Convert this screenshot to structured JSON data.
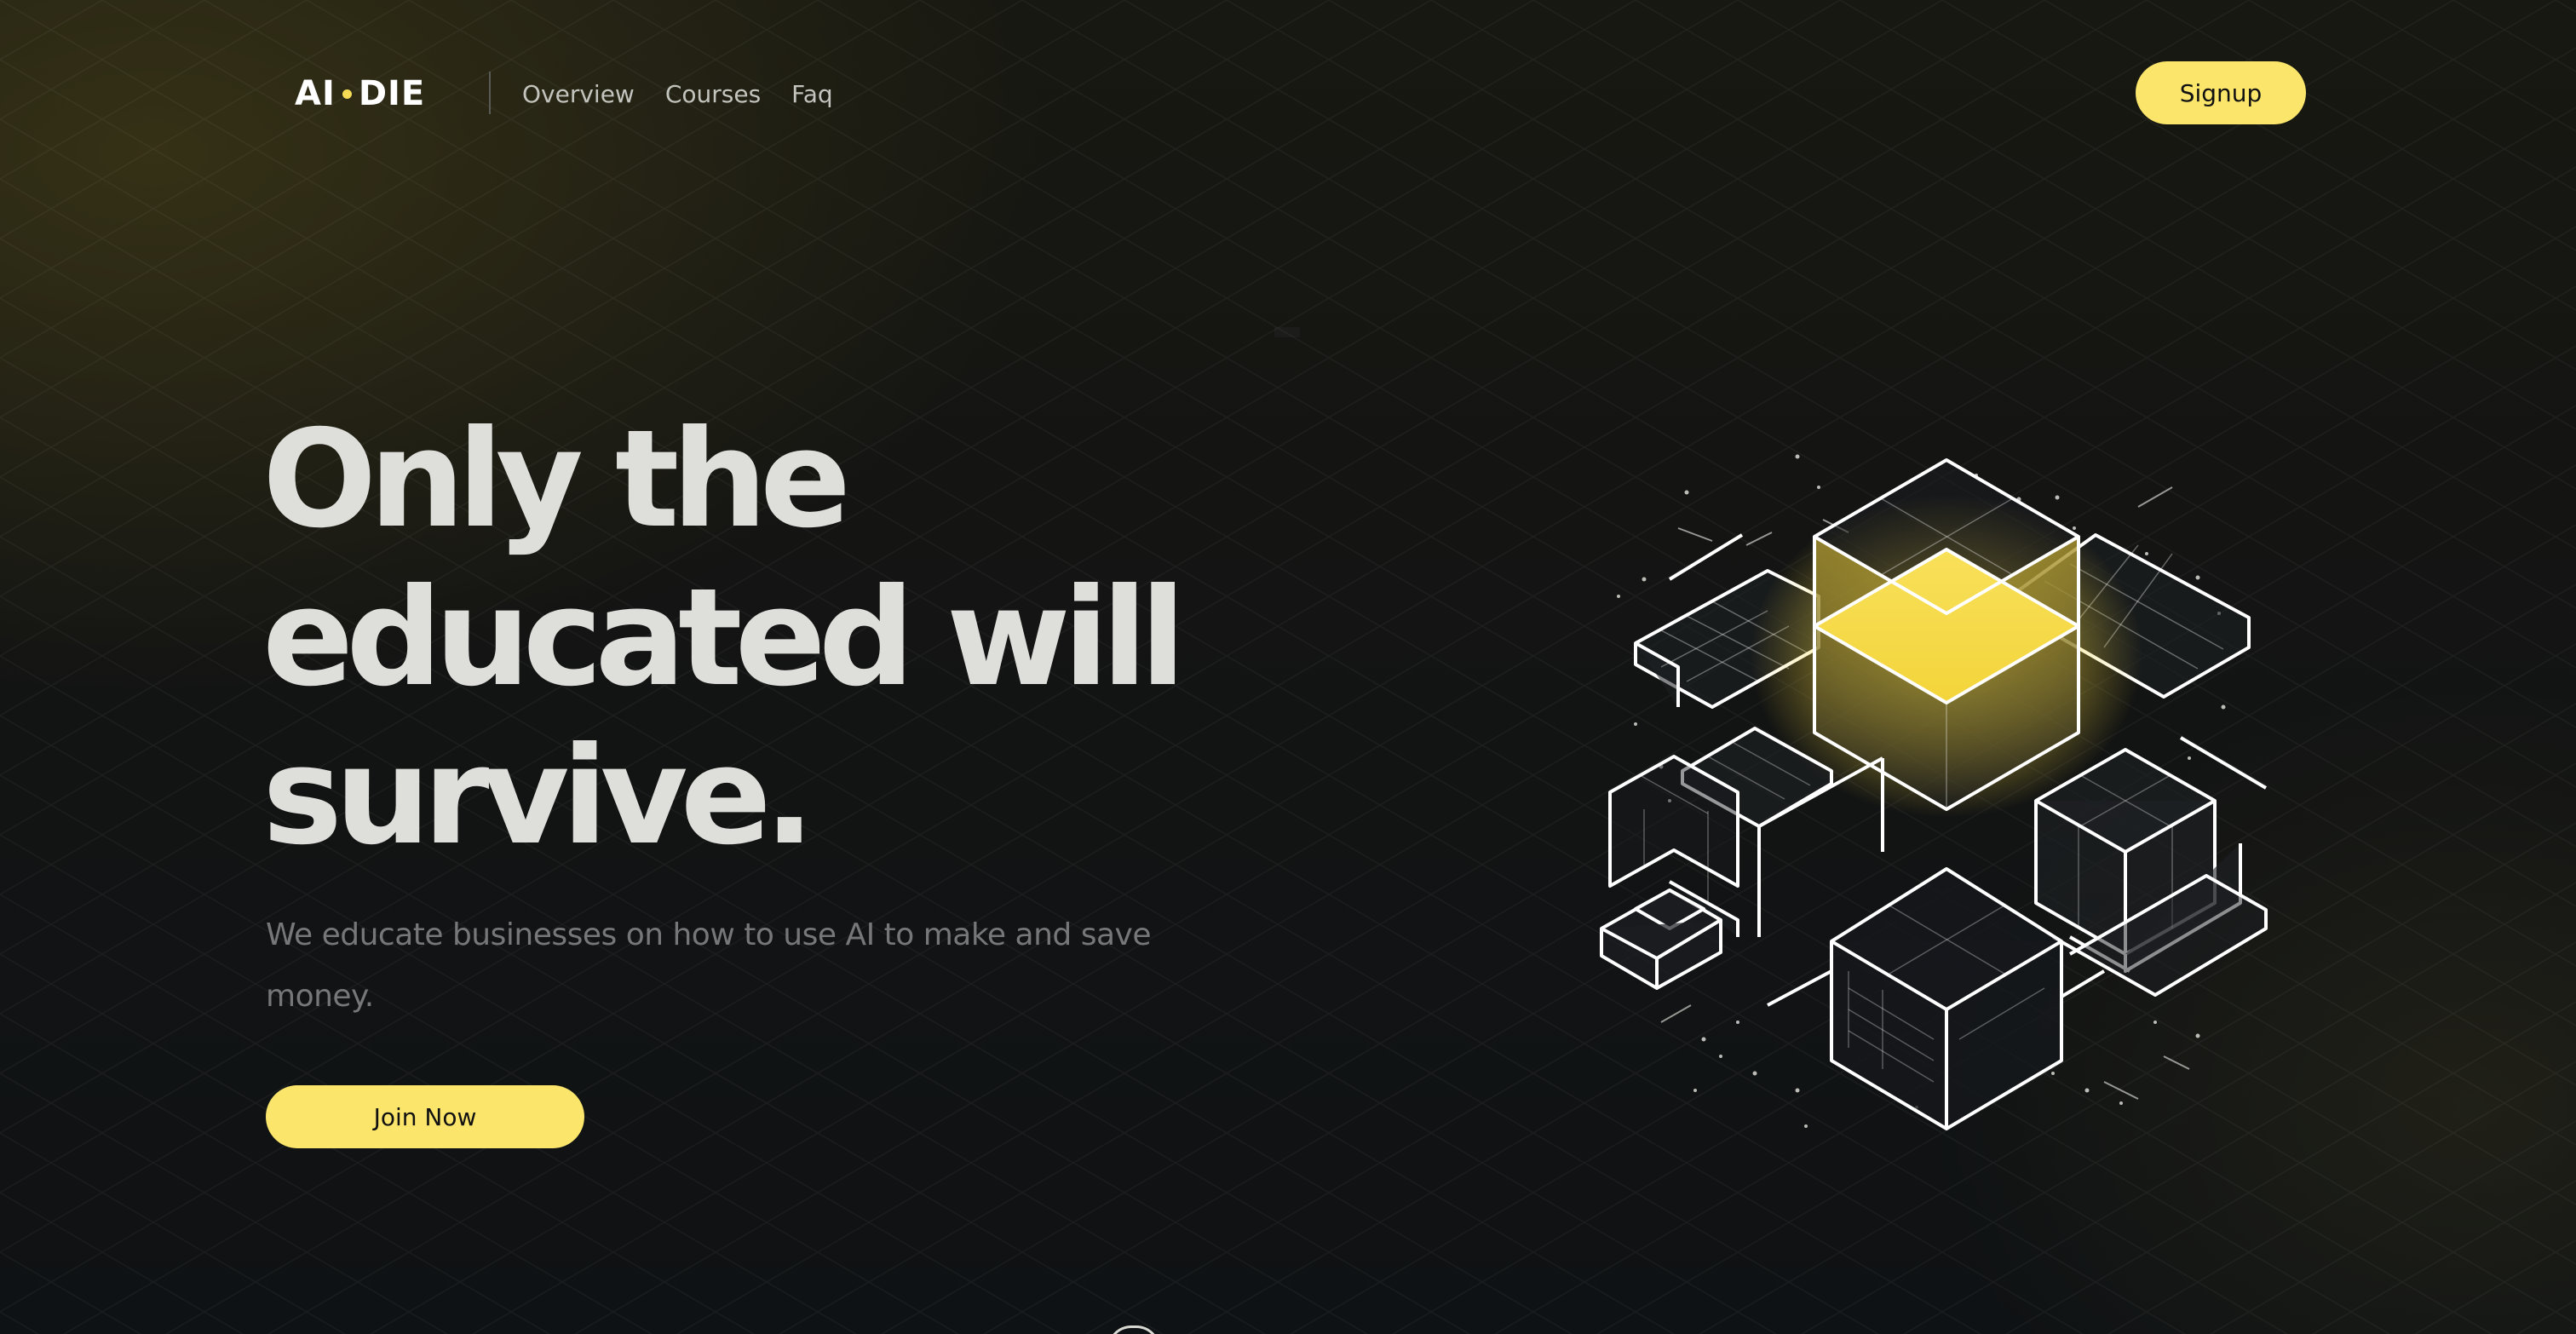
{
  "nav": {
    "logo_left": "AI",
    "logo_right": "DIE",
    "links": [
      {
        "label": "Overview"
      },
      {
        "label": "Courses"
      },
      {
        "label": "Faq"
      }
    ],
    "signup_label": "Signup"
  },
  "hero": {
    "title_lines": [
      "Only the",
      "educated will",
      "survive."
    ],
    "subtitle": "We educate businesses on how to use AI to make and save money.",
    "cta_label": "Join Now"
  },
  "colors": {
    "accent": "#fbe66b",
    "logo_dot": "#f6dd55",
    "background": "#101214",
    "title_text": "#dededa",
    "subtitle_text": "#77777a"
  },
  "icons": {
    "logo_separator": "dot",
    "hero_art": "isometric-cube-network-illustration",
    "scroll": "scroll-down-indicator"
  }
}
